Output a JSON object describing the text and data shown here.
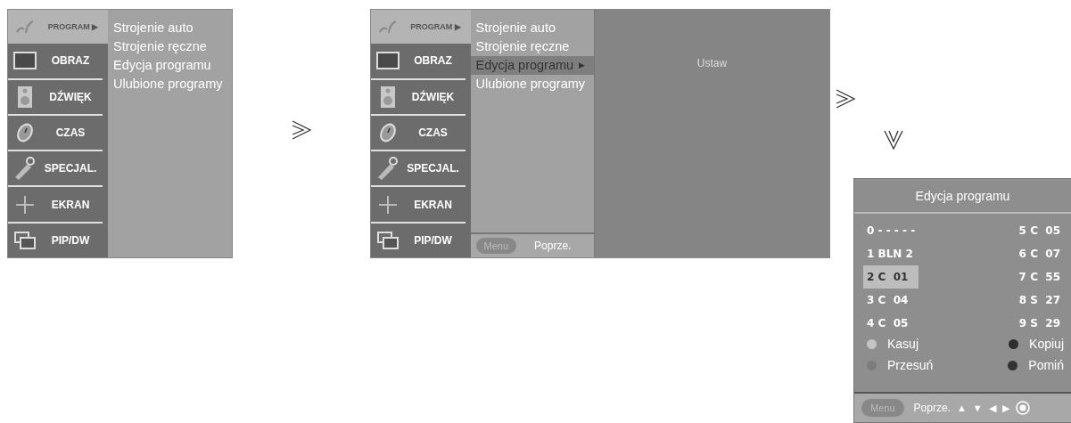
{
  "menus": [
    {
      "sidebar": [
        {
          "kind": "program",
          "label": "PROGRAM",
          "arrow": "▶",
          "selected": true
        },
        {
          "kind": "picture",
          "label": "OBRAZ",
          "selected": false
        },
        {
          "kind": "sound",
          "label": "DŹWIĘK",
          "selected": false
        },
        {
          "kind": "time",
          "label": "CZAS",
          "selected": false
        },
        {
          "kind": "special",
          "label": "SPECJAL.",
          "selected": false
        },
        {
          "kind": "screen",
          "label": "EKRAN",
          "selected": false
        },
        {
          "kind": "pip",
          "label": "PIP/DW",
          "selected": false
        }
      ],
      "submenu": [
        {
          "label": "Strojenie auto",
          "selected": false
        },
        {
          "label": "Strojenie ręczne",
          "selected": false
        },
        {
          "label": "Edycja programu",
          "selected": false
        },
        {
          "label": "Ulubione programy",
          "selected": false
        }
      ]
    },
    {
      "sidebar": [
        {
          "kind": "program",
          "label": "PROGRAM",
          "arrow": "▶",
          "selected": true
        },
        {
          "kind": "picture",
          "label": "OBRAZ",
          "selected": false
        },
        {
          "kind": "sound",
          "label": "DŹWIĘK",
          "selected": false
        },
        {
          "kind": "time",
          "label": "CZAS",
          "selected": false
        },
        {
          "kind": "special",
          "label": "SPECJAL.",
          "selected": false
        },
        {
          "kind": "screen",
          "label": "EKRAN",
          "selected": false
        },
        {
          "kind": "pip",
          "label": "PIP/DW",
          "selected": false
        }
      ],
      "submenu": [
        {
          "label": "Strojenie auto",
          "selected": false
        },
        {
          "label": "Strojenie ręczne",
          "selected": false
        },
        {
          "label": "Edycja programu",
          "arrow": "▶",
          "selected": true
        },
        {
          "label": "Ulubione programy",
          "selected": false
        }
      ],
      "footer": {
        "menu_button": "Menu",
        "back": "Poprze."
      },
      "panel": {
        "label": "Ustaw"
      }
    }
  ],
  "program_edit": {
    "title": "Edycja programu",
    "channels": [
      {
        "number": "0",
        "name": "- - - - -",
        "selected": false
      },
      {
        "number": "1",
        "name": "BLN 2",
        "selected": false
      },
      {
        "number": "2",
        "name": "C  01",
        "selected": true
      },
      {
        "number": "3",
        "name": "C  04",
        "selected": false
      },
      {
        "number": "4",
        "name": "C  05",
        "selected": false
      },
      {
        "number": "5",
        "name": "C  05",
        "selected": false
      },
      {
        "number": "6",
        "name": "C  07",
        "selected": false
      },
      {
        "number": "7",
        "name": "C  55",
        "selected": false
      },
      {
        "number": "8",
        "name": "S  27",
        "selected": false
      },
      {
        "number": "9",
        "name": "S  29",
        "selected": false
      }
    ],
    "legend": [
      {
        "label": "Kasuj",
        "color": "#c4c4c4"
      },
      {
        "label": "Kopiuj",
        "color": "#2e2e2e"
      },
      {
        "label": "Przesuń",
        "color": "#7c7c7c"
      },
      {
        "label": "Pomiń",
        "color": "#333333"
      }
    ],
    "footer": {
      "menu_button": "Menu",
      "back": "Poprze.",
      "nav": [
        "▲",
        "▼",
        "◀",
        "▶"
      ]
    }
  }
}
